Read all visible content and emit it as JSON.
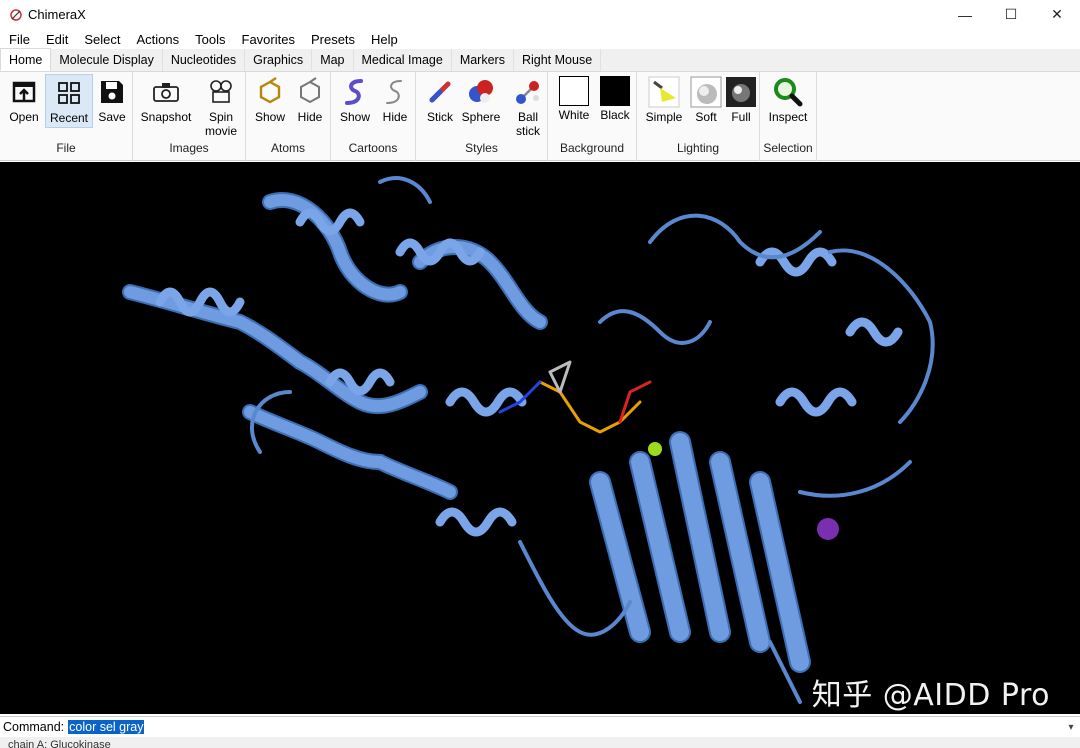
{
  "window": {
    "title": "ChimeraX",
    "minimize": "—",
    "maximize": "☐",
    "close": "✕"
  },
  "menu": [
    "File",
    "Edit",
    "Select",
    "Actions",
    "Tools",
    "Favorites",
    "Presets",
    "Help"
  ],
  "tabs": [
    "Home",
    "Molecule Display",
    "Nucleotides",
    "Graphics",
    "Map",
    "Medical Image",
    "Markers",
    "Right Mouse"
  ],
  "active_tab": "Home",
  "ribbon": {
    "file": {
      "label": "File",
      "open": "Open",
      "recent": "Recent",
      "save": "Save"
    },
    "images": {
      "label": "Images",
      "snapshot": "Snapshot",
      "spin1": "Spin",
      "spin2": "movie"
    },
    "atoms": {
      "label": "Atoms",
      "show": "Show",
      "hide": "Hide"
    },
    "cartoons": {
      "label": "Cartoons",
      "show": "Show",
      "hide": "Hide"
    },
    "styles": {
      "label": "Styles",
      "stick": "Stick",
      "sphere": "Sphere",
      "ball1": "Ball",
      "ball2": "stick"
    },
    "background": {
      "label": "Background",
      "white": "White",
      "black": "Black"
    },
    "lighting": {
      "label": "Lighting",
      "simple": "Simple",
      "soft": "Soft",
      "full": "Full"
    },
    "selection": {
      "label": "Selection",
      "inspect": "Inspect"
    }
  },
  "viewport": {
    "watermark": "知乎 @AIDD Pro",
    "background_color": "#000000",
    "ribbon_color": "#6f9be0"
  },
  "command": {
    "label": "Command:",
    "value": "color sel gray"
  },
  "status": {
    "text": "chain A: Glucokinase"
  }
}
